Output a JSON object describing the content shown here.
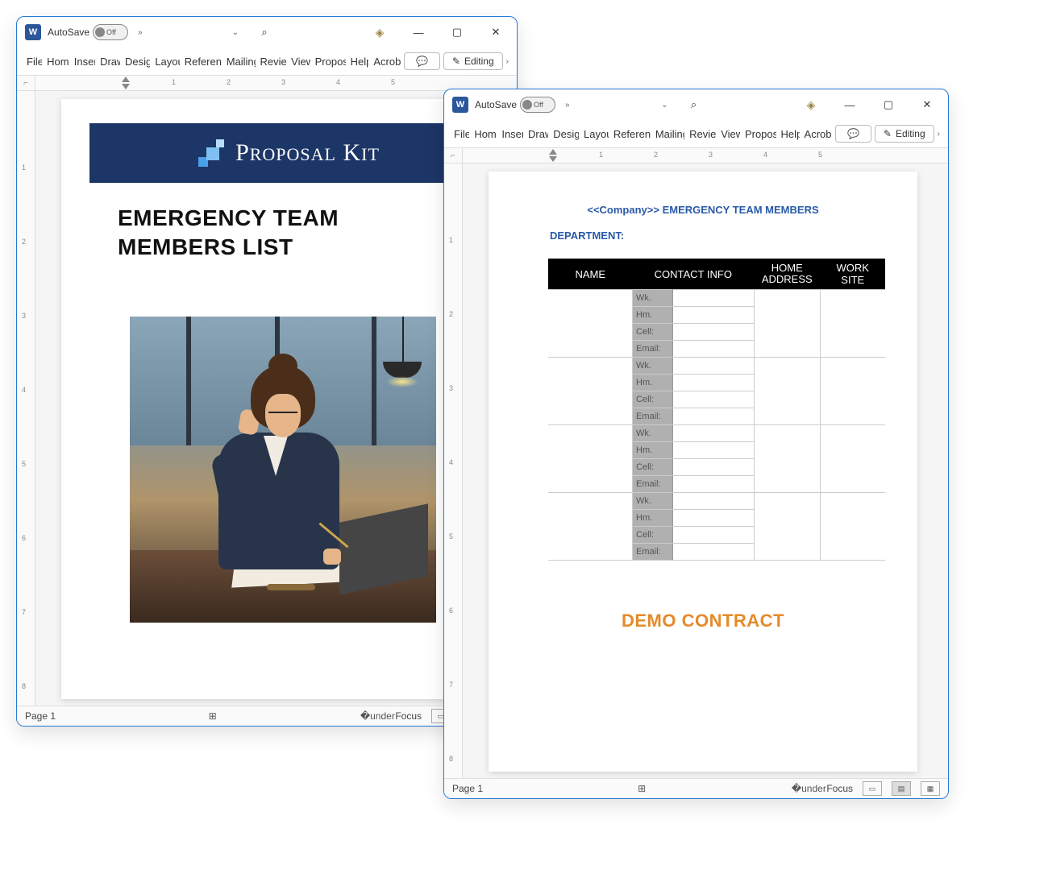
{
  "window1": {
    "autosave_label": "AutoSave",
    "autosave_state": "Off",
    "ribbon": [
      "File",
      "Home",
      "Insert",
      "Draw",
      "Design",
      "Layout",
      "References",
      "Mailings",
      "Review",
      "View",
      "Proposal",
      "Help",
      "Acrobat"
    ],
    "editing_label": "Editing",
    "ruler_h": [
      "1",
      "2",
      "3",
      "4",
      "5"
    ],
    "ruler_v": [
      "1",
      "2",
      "3",
      "4",
      "5",
      "6",
      "7",
      "8"
    ],
    "page": {
      "brand": "Proposal Kit",
      "title_line1": "EMERGENCY TEAM",
      "title_line2": "MEMBERS LIST"
    },
    "status_page": "Page 1",
    "focus_label": "Focus"
  },
  "window2": {
    "autosave_label": "AutoSave",
    "autosave_state": "Off",
    "ribbon": [
      "File",
      "Home",
      "Insert",
      "Draw",
      "Design",
      "Layout",
      "References",
      "Mailings",
      "Review",
      "View",
      "Proposal",
      "Help",
      "Acrobat"
    ],
    "editing_label": "Editing",
    "ruler_h": [
      "1",
      "2",
      "3",
      "4",
      "5"
    ],
    "ruler_v": [
      "1",
      "2",
      "3",
      "4",
      "5",
      "6",
      "7",
      "8"
    ],
    "page": {
      "heading": "<<Company>> EMERGENCY TEAM MEMBERS",
      "department_label": "DEPARTMENT:",
      "columns": {
        "name": "NAME",
        "contact": "CONTACT INFO",
        "home": "HOME ADDRESS",
        "site": "WORK SITE"
      },
      "row_labels": [
        "Wk.",
        "Hm.",
        "Cell:",
        "Email:"
      ],
      "watermark": "DEMO CONTRACT"
    },
    "status_page": "Page 1",
    "focus_label": "Focus"
  }
}
